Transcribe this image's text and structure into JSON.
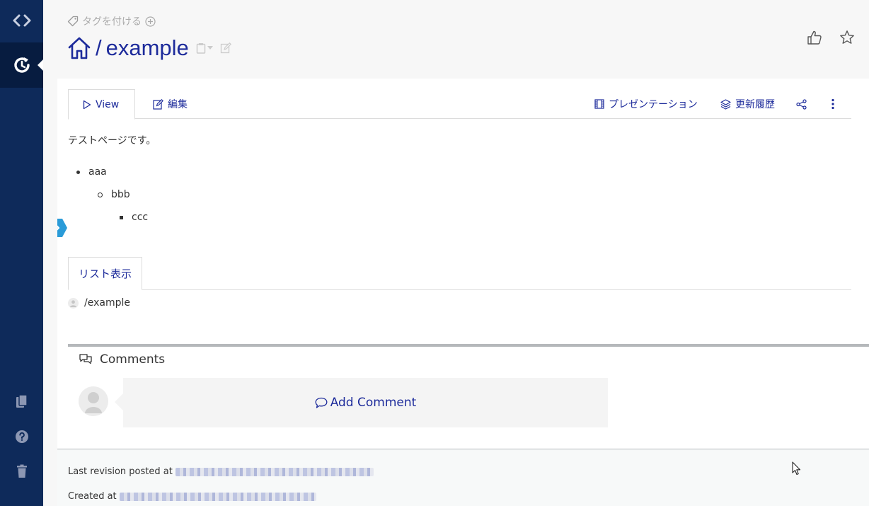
{
  "header": {
    "tag_label": "タグを付ける",
    "title_separator": "/",
    "title": "example"
  },
  "tabs": {
    "view": "View",
    "edit": "編集",
    "presentation": "プレゼンテーション",
    "history": "更新履歴"
  },
  "content": {
    "intro": "テストページです。",
    "list": [
      {
        "text": "aaa",
        "level": 1
      },
      {
        "text": "bbb",
        "level": 2
      },
      {
        "text": "ccc",
        "level": 3
      }
    ]
  },
  "list_view": {
    "tab_label": "リスト表示",
    "pages": [
      "/example"
    ]
  },
  "comments": {
    "title": "Comments",
    "add_label": "Add Comment"
  },
  "footer": {
    "last_revision_label": "Last revision posted at",
    "created_label": "Created at"
  },
  "colors": {
    "sidebar": "#0e2a5a",
    "accent": "#1d2b9b",
    "toggle": "#2a9bd8"
  }
}
